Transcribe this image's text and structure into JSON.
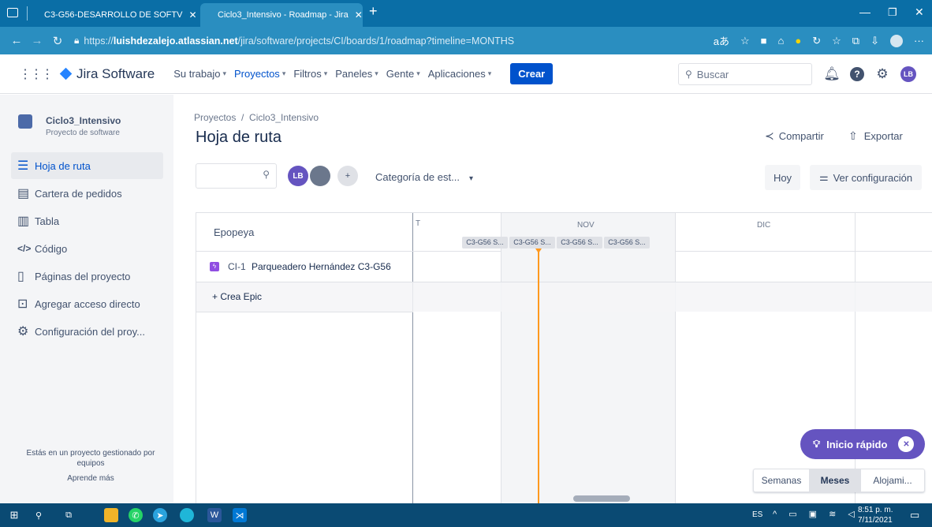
{
  "browser": {
    "tabs": [
      {
        "title": "C3-G56-DESARROLLO DE SOFTV"
      },
      {
        "title": "Ciclo3_Intensivo - Roadmap - Jira"
      }
    ],
    "url_prefix": "https://",
    "url_host": "luishdezalejo.atlassian.net",
    "url_path": "/jira/software/projects/CI/boards/1/roadmap?timeline=MONTHS"
  },
  "topnav": {
    "logo": "Jira Software",
    "items": [
      {
        "label": "Su trabajo"
      },
      {
        "label": "Proyectos"
      },
      {
        "label": "Filtros"
      },
      {
        "label": "Paneles"
      },
      {
        "label": "Gente"
      },
      {
        "label": "Aplicaciones"
      }
    ],
    "create_label": "Crear",
    "search_placeholder": "Buscar",
    "user_initials": "LB"
  },
  "sidebar": {
    "project_name": "Ciclo3_Intensivo",
    "project_type": "Proyecto de software",
    "items": [
      {
        "label": "Hoja de ruta",
        "icon": "roadmap-icon"
      },
      {
        "label": "Cartera de pedidos",
        "icon": "backlog-icon"
      },
      {
        "label": "Tabla",
        "icon": "board-icon"
      },
      {
        "label": "Código",
        "icon": "code-icon"
      },
      {
        "label": "Páginas del proyecto",
        "icon": "pages-icon"
      },
      {
        "label": "Agregar acceso directo",
        "icon": "add-shortcut-icon"
      },
      {
        "label": "Configuración del proy...",
        "icon": "gear-icon"
      }
    ],
    "footer_text": "Estás en un proyecto gestionado por equipos",
    "learn_more": "Aprende más"
  },
  "main": {
    "breadcrumb": "Proyectos  /  Ciclo3_Intensivo",
    "title": "Hoja de ruta",
    "share_label": "Compartir",
    "export_label": "Exportar",
    "filter_label": "Categoría de est...",
    "today_label": "Hoy",
    "settings_label": "Ver configuración",
    "column_header": "Epopeya",
    "months": [
      "T",
      "NOV",
      "DIC"
    ],
    "sprints": [
      "C3-G56 S...",
      "C3-G56 S...",
      "C3-G56 S...",
      "C3-G56 S..."
    ],
    "epic": {
      "key": "CI-1",
      "name": "Parqueadero Hernández C3-G56"
    },
    "create_epic": "+ Crea Epic",
    "quickstart_label": "Inicio rápido",
    "views": [
      "Semanas",
      "Meses",
      "Alojami..."
    ],
    "active_view": "Meses"
  },
  "taskbar": {
    "lang": "ES",
    "time": "8:51 p. m.",
    "date": "7/11/2021"
  },
  "colors": {
    "accent": "#0052cc",
    "browser_tabbar": "#0a6ea6",
    "today_marker": "#ff991f",
    "epic_purple": "#904ee2",
    "quickstart": "#6554c0"
  }
}
